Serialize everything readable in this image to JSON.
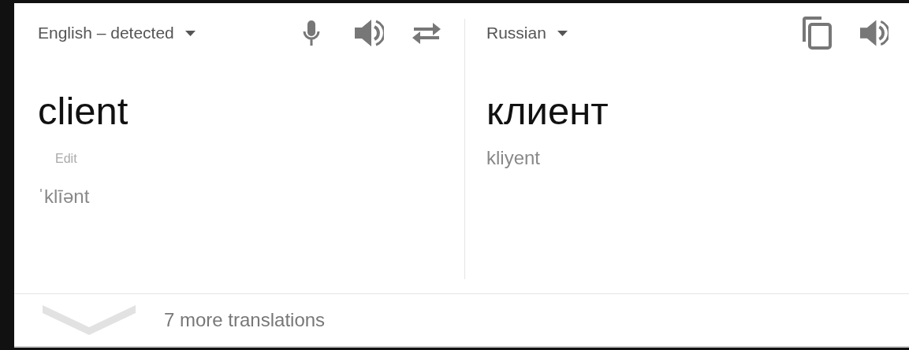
{
  "source": {
    "language": "English – detected",
    "text": "client",
    "edit_label": "Edit",
    "phonetic": "ˈklīənt"
  },
  "target": {
    "language": "Russian",
    "text": "клиент",
    "transliteration": "kliyent"
  },
  "footer": {
    "label": "7 more translations",
    "expanded": false
  }
}
